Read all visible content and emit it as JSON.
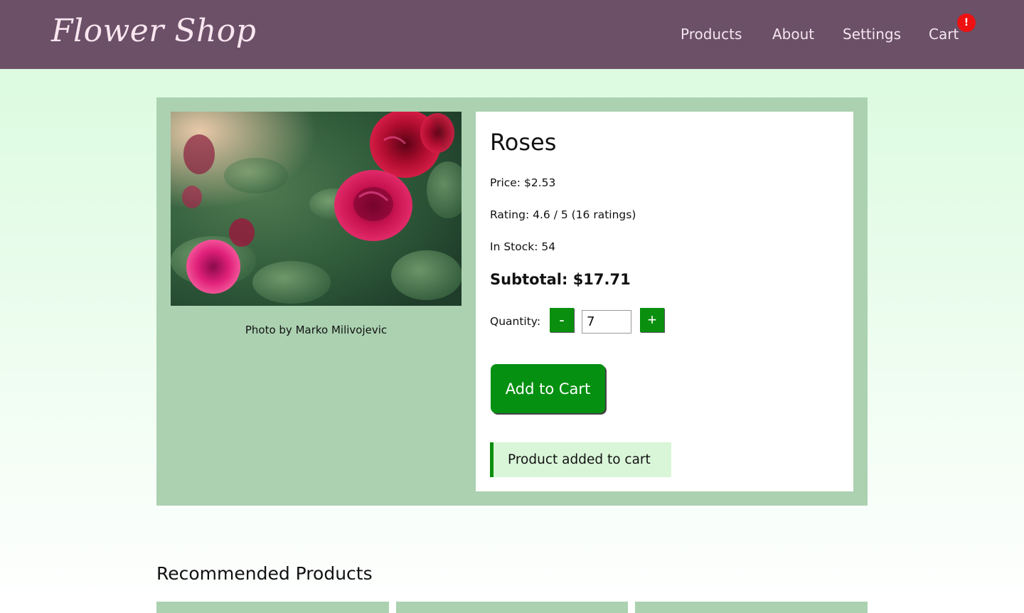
{
  "header": {
    "logo": "Flower Shop",
    "nav": [
      {
        "label": "Products"
      },
      {
        "label": "About"
      },
      {
        "label": "Settings"
      },
      {
        "label": "Cart"
      }
    ],
    "cart_badge": "!"
  },
  "product": {
    "name": "Roses",
    "price": "Price: $2.53",
    "rating": "Rating: 4.6 / 5 (16 ratings)",
    "stock": "In Stock: 54",
    "subtotal": "Subtotal: $17.71",
    "quantity_label": "Quantity:",
    "decrement_label": "-",
    "increment_label": "+",
    "quantity_value": "7",
    "add_to_cart_label": "Add to Cart",
    "toast": "Product added to cart",
    "photo_credit": "Photo by Marko Milivojevic"
  },
  "recommended": {
    "title": "Recommended Products"
  },
  "colors": {
    "header_bg": "#6b5068",
    "panel_bg": "#abd1b1",
    "accent_green": "#0a8f0f",
    "badge_red": "#ee1111"
  }
}
